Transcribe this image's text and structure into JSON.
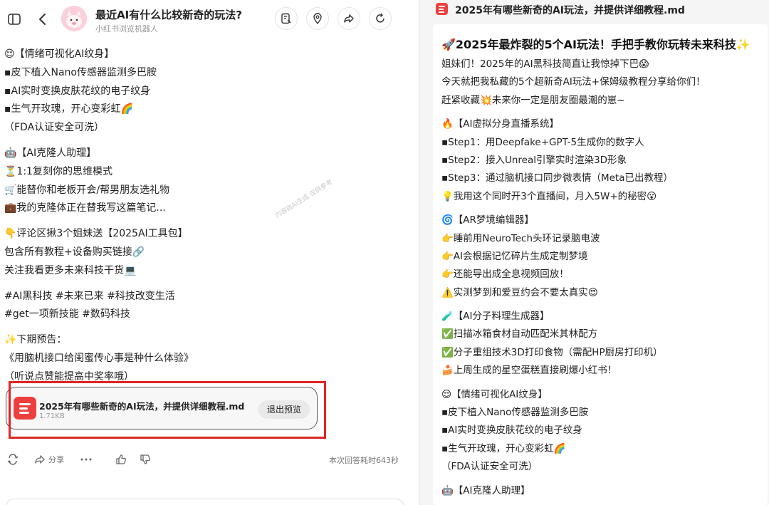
{
  "chat": {
    "title": "最近AI有什么比较新奇的玩法?",
    "subtitle": "小红书浏览机器人",
    "watermark": "内容由AI生成 仅供参考"
  },
  "message": {
    "blocks": [
      [
        "😌【情绪可视化AI纹身】",
        "▪皮下植入Nano传感器监测多巴胺",
        "▪AI实时变换皮肤花纹的电子纹身",
        "▪生气开玫瑰，开心变彩虹🌈",
        "（FDA认证安全可洗）"
      ],
      [
        "🤖【AI克隆人助理】",
        "⏳1:1复刻你的思维模式",
        "🛒能替你和老板开会/帮男朋友选礼物",
        "💼我的克隆体正在替我写这篇笔记..."
      ],
      [
        "👇评论区揪3个姐妹送【2025AI工具包】",
        "包含所有教程+设备购买链接🔗",
        "关注我看更多未来科技干货💻"
      ],
      [
        "#AI黑科技 #未来已来 #科技改变生活",
        "#get一项新技能 #数码科技"
      ],
      [
        "✨下期预告：",
        "《用脑机接口给闺蜜传心事是种什么体验》",
        "（听说点赞能提高中奖率哦）"
      ]
    ]
  },
  "file_card": {
    "name": "2025年有哪些新奇的AI玩法，并提供详细教程.md",
    "size": "1.71KB",
    "exit_label": "退出预览"
  },
  "actions": {
    "share_label": "分享",
    "timing": "本次回答耗时643秒"
  },
  "preview": {
    "file_title": "2025年有哪些新奇的AI玩法，并提供详细教程.md",
    "heading": "🚀2025年最炸裂的5个AI玩法！手把手教你玩转未来科技✨",
    "blocks": [
      [
        "姐妹们！2025年的AI黑科技简直让我惊掉下巴😱",
        "今天就把我私藏的5个超新奇AI玩法+保姆级教程分享给你们！",
        "赶紧收藏💥未来你一定是朋友圈最潮的崽~"
      ],
      [
        "🔥【AI虚拟分身直播系统】",
        "▪Step1：用Deepfake+GPT-5生成你的数字人",
        "▪Step2：接入Unreal引擎实时渲染3D形象",
        "▪Step3：通过脑机接口同步微表情（Meta已出教程）",
        "💡我用这个同时开3个直播间，月入5W+的秘密😮"
      ],
      [
        "🌀【AR梦境编辑器】",
        "👉睡前用NeuroTech头环记录脑电波",
        "👉AI会根据记忆碎片生成定制梦境",
        "👉还能导出成全息视频回放！",
        "⚠️实测梦到和爱豆约会不要太真实😍"
      ],
      [
        "🧪【AI分子料理生成器】",
        "✅扫描冰箱食材自动匹配米其林配方",
        "✅分子重组技术3D打印食物（需配HP厨房打印机）",
        "🍰上周生成的星空蛋糕直接刷爆小红书！"
      ],
      [
        "😌【情绪可视化AI纹身】",
        "▪皮下植入Nano传感器监测多巴胺",
        "▪AI实时变换皮肤花纹的电子纹身",
        "▪生气开玫瑰，开心变彩虹🌈",
        "（FDA认证安全可洗）"
      ],
      [
        "🤖【AI克隆人助理】"
      ]
    ]
  },
  "colors": {
    "accent_red": "#ee3f3f",
    "highlight": "#e02424"
  }
}
